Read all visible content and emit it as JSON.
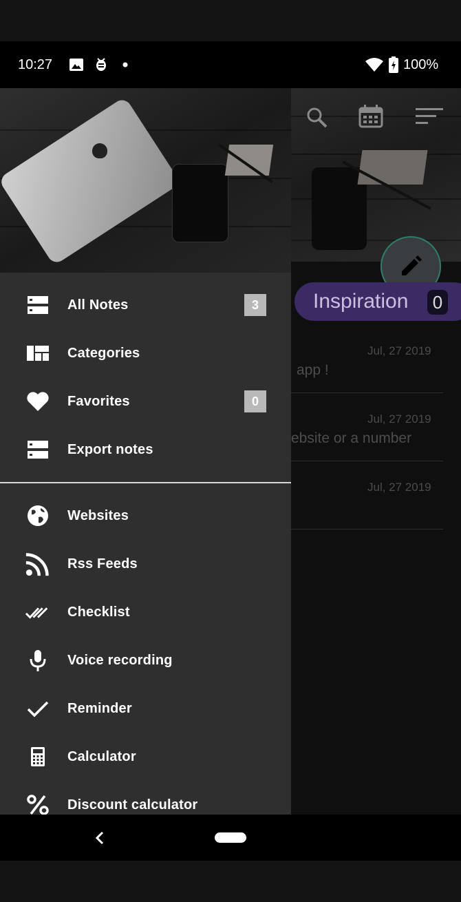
{
  "status_bar": {
    "time": "10:27",
    "battery": "100%",
    "icons": [
      "image-icon",
      "android-debug-icon",
      "dot-icon",
      "wifi-icon",
      "battery-charging-icon"
    ]
  },
  "background_app": {
    "toolbar_icons": [
      "search-icon",
      "calendar-icon",
      "sort-icon"
    ],
    "fab_icon": "pencil-icon",
    "category_chip": {
      "label": "Inspiration",
      "count": "0"
    },
    "notes": [
      {
        "date": "Jul, 27 2019",
        "text": "app !"
      },
      {
        "date": "Jul, 27 2019",
        "text": "ebsite or a number"
      },
      {
        "date": "Jul, 27 2019",
        "text": ""
      }
    ]
  },
  "drawer": {
    "primary_items": [
      {
        "label": "All Notes",
        "icon": "storage-icon",
        "badge": "3"
      },
      {
        "label": "Categories",
        "icon": "dashboard-icon"
      },
      {
        "label": "Favorites",
        "icon": "heart-icon",
        "badge": "0"
      },
      {
        "label": "Export notes",
        "icon": "storage-icon"
      }
    ],
    "tool_items": [
      {
        "label": "Websites",
        "icon": "globe-icon"
      },
      {
        "label": "Rss Feeds",
        "icon": "rss-icon"
      },
      {
        "label": "Checklist",
        "icon": "double-check-icon"
      },
      {
        "label": "Voice recording",
        "icon": "microphone-icon"
      },
      {
        "label": "Reminder",
        "icon": "check-icon"
      },
      {
        "label": "Calculator",
        "icon": "calculator-icon"
      },
      {
        "label": "Discount calculator",
        "icon": "percent-icon"
      }
    ]
  },
  "nav_bar": {
    "icons": [
      "back-icon",
      "home-pill-icon"
    ]
  },
  "colors": {
    "drawer_bg": "#2f2f2f",
    "badge_bg": "#b9b9b9",
    "chip_bg": "#3b2a63",
    "fab_ring": "#2e7d6a"
  }
}
